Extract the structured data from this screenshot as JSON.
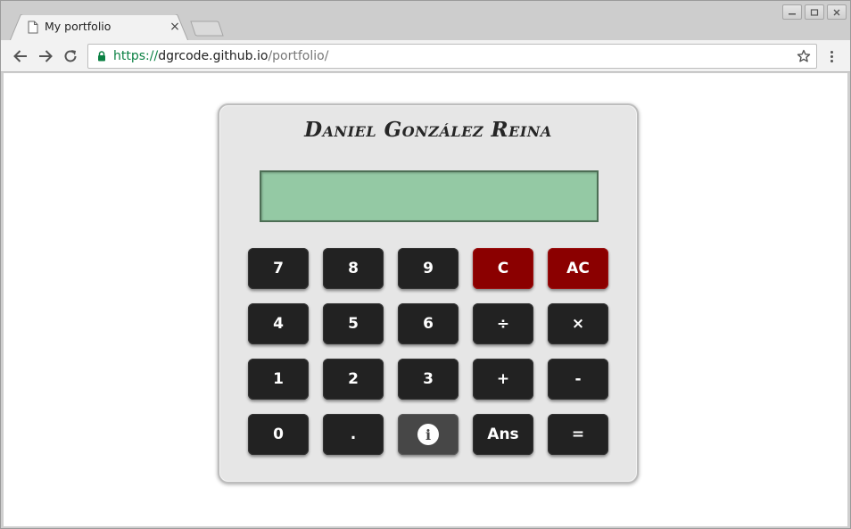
{
  "browser": {
    "tab_title": "My portfolio",
    "tab_close": "×",
    "url_scheme": "https://",
    "url_host": "dgrcode.github.io",
    "url_path": "/portfolio/"
  },
  "calculator": {
    "title": "Daniel González Reina",
    "display_value": "",
    "keys": [
      {
        "label": "7",
        "style": "dark"
      },
      {
        "label": "8",
        "style": "dark"
      },
      {
        "label": "9",
        "style": "dark"
      },
      {
        "label": "C",
        "style": "red"
      },
      {
        "label": "AC",
        "style": "red"
      },
      {
        "label": "4",
        "style": "dark"
      },
      {
        "label": "5",
        "style": "dark"
      },
      {
        "label": "6",
        "style": "dark"
      },
      {
        "label": "÷",
        "style": "dark"
      },
      {
        "label": "×",
        "style": "dark"
      },
      {
        "label": "1",
        "style": "dark"
      },
      {
        "label": "2",
        "style": "dark"
      },
      {
        "label": "3",
        "style": "dark"
      },
      {
        "label": "+",
        "style": "dark"
      },
      {
        "label": "-",
        "style": "dark"
      },
      {
        "label": "0",
        "style": "dark"
      },
      {
        "label": ".",
        "style": "dark"
      },
      {
        "label": "i",
        "style": "grey",
        "icon": "info-icon"
      },
      {
        "label": "Ans",
        "style": "dark"
      },
      {
        "label": "=",
        "style": "dark"
      }
    ]
  },
  "colors": {
    "display": "#94c9a4",
    "key_dark": "#222222",
    "key_red": "#8b0000",
    "key_info": "#474747",
    "secure_green": "#0b8043"
  }
}
